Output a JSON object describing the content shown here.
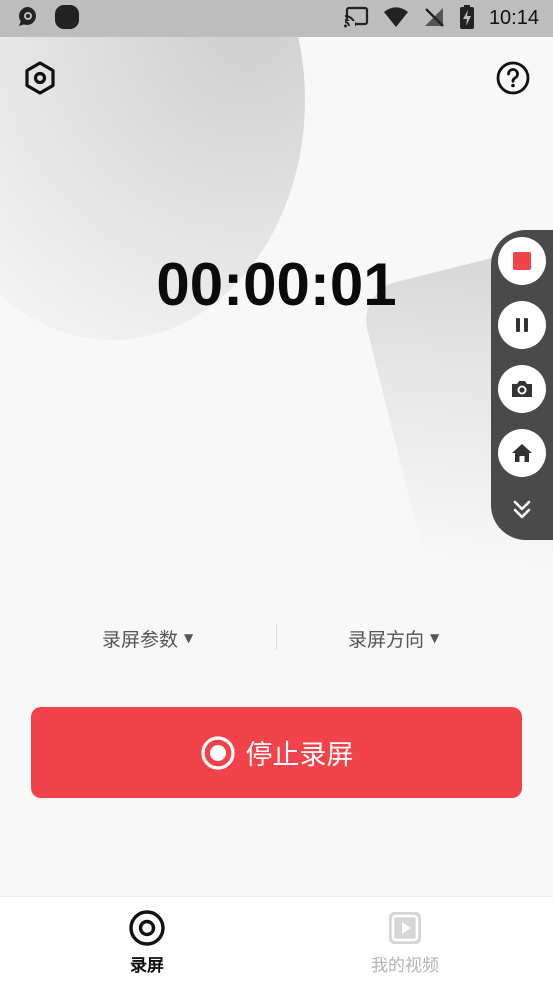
{
  "status_bar": {
    "time": "10:14"
  },
  "header": {
    "left_icon": "settings-hexagon-icon",
    "right_icon": "help-icon"
  },
  "timer": {
    "value": "00:00:01"
  },
  "floating_toolbar": {
    "buttons": [
      "stop-icon",
      "pause-icon",
      "camera-icon",
      "home-icon",
      "collapse-icon"
    ],
    "stop_color": "#f2434a"
  },
  "options": {
    "params_label": "录屏参数",
    "orientation_label": "录屏方向"
  },
  "main_action": {
    "label": "停止录屏",
    "color": "#f2434a"
  },
  "bottom_nav": {
    "items": [
      {
        "label": "录屏",
        "active": true
      },
      {
        "label": "我的视频",
        "active": false
      }
    ]
  }
}
